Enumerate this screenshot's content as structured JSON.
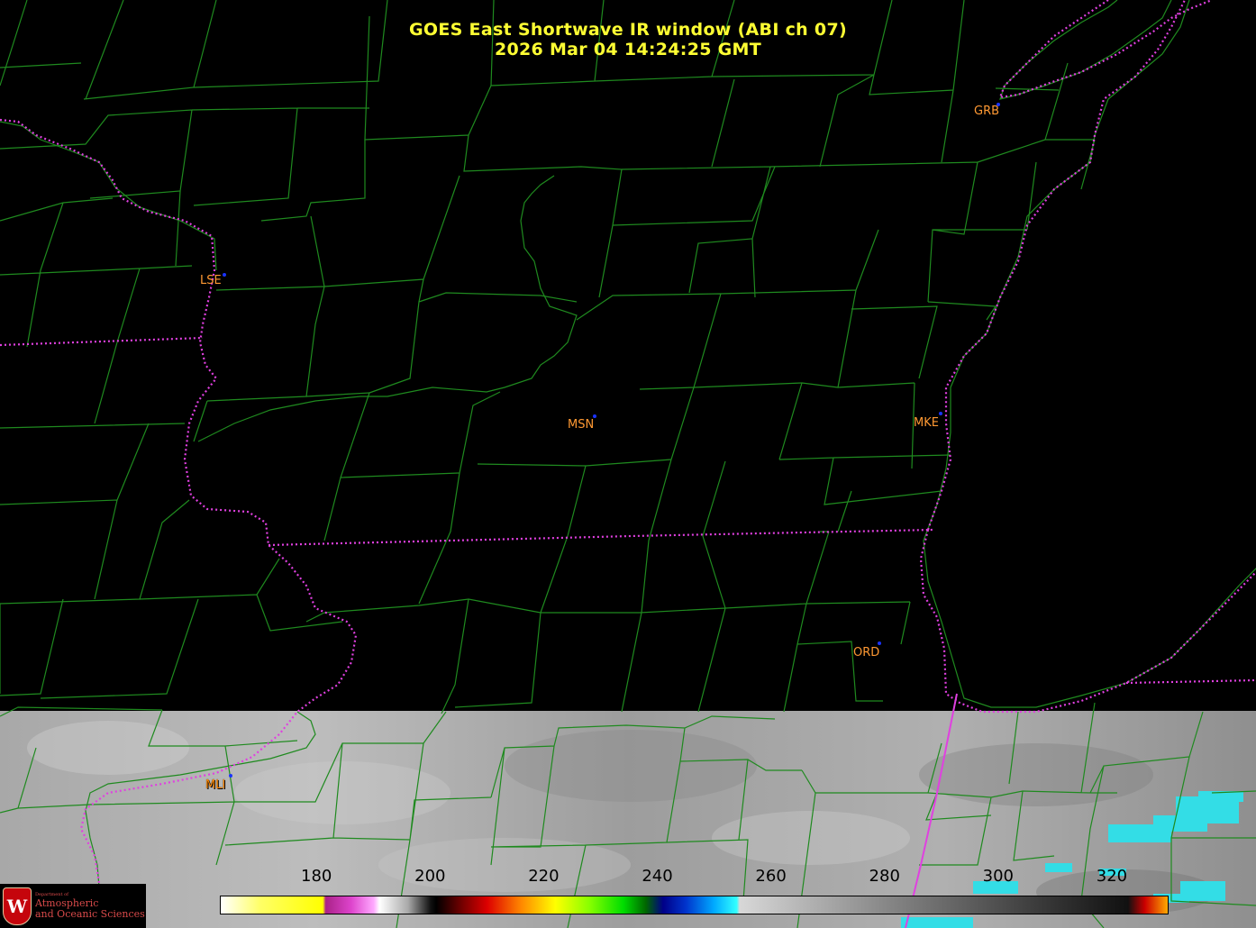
{
  "title": {
    "line1": "GOES East Shortwave IR window (ABI ch 07)",
    "line2": "2026 Mar 04  14:24:25 GMT"
  },
  "stations": [
    {
      "id": "GRB",
      "label": "GRB"
    },
    {
      "id": "LSE",
      "label": "LSE"
    },
    {
      "id": "MSN",
      "label": "MSN"
    },
    {
      "id": "MKE",
      "label": "MKE"
    },
    {
      "id": "ORD",
      "label": "ORD"
    },
    {
      "id": "MLI",
      "label": "MLI"
    }
  ],
  "colorbar": {
    "unit": "",
    "min": 163,
    "max": 330,
    "ticks": [
      "180",
      "200",
      "220",
      "240",
      "260",
      "280",
      "300",
      "320"
    ],
    "tick_values": [
      180,
      200,
      220,
      240,
      260,
      280,
      300,
      320
    ]
  },
  "logo": {
    "seal": "W",
    "dept": "Department of",
    "line1": "Atmospheric",
    "line2": "and Oceanic Sciences"
  },
  "colors": {
    "title": "#ffff33",
    "station_label": "#ff9933",
    "station_dot": "#1a33ff",
    "county_lines": "#1f8a1f",
    "state_lines": "#e040e0",
    "background": "#000000",
    "cloud_field": "#a0a0a0",
    "cold_cloud": "#33dde6"
  }
}
